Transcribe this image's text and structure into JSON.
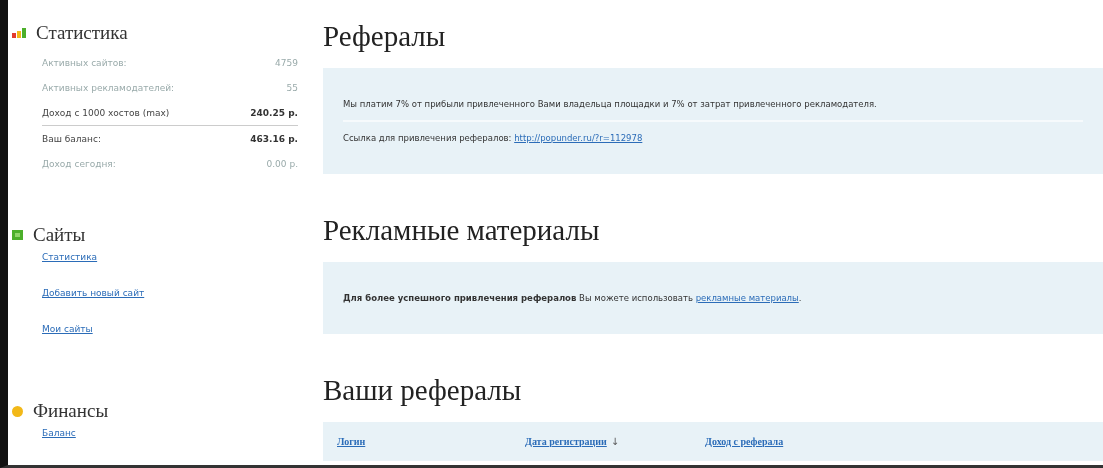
{
  "sidebar": [
    {
      "title": "Статистика",
      "kind": "bars",
      "color": "#4caf2a",
      "stats": [
        {
          "label": "Активных сайтов:",
          "value": "4759",
          "muted": true,
          "bold": false
        },
        {
          "label": "Активных рекламодателей:",
          "value": "55",
          "muted": true,
          "bold": false
        },
        {
          "label": "Доход с 1000 хостов (max)",
          "value": "240.25 р.",
          "muted": false,
          "bold": true
        },
        {
          "label": "Ваш баланс:",
          "value": "463.16 р.",
          "muted": false,
          "bold": true
        },
        {
          "label": "Доход сегодня:",
          "value": "0.00 р.",
          "muted": true,
          "bold": false
        }
      ]
    },
    {
      "title": "Сайты",
      "kind": "square",
      "color": "#4caf2a",
      "links": [
        "Статистика",
        "Добавить новый сайт",
        "Мои сайты"
      ]
    },
    {
      "title": "Финансы",
      "kind": "circle",
      "color": "#f2b818",
      "links": [
        "Баланс"
      ]
    }
  ],
  "main": [
    {
      "title": "Рефералы",
      "panel": {
        "kind": "lines",
        "lines": [
          {
            "text": "Мы платим 7% от прибыли привлеченного Вами владельца площадки и 7% от затрат привлеченного рекламодателя."
          },
          {
            "text": "Ссылка для привлечения рефералов: ",
            "link": "http://popunder.ru/?r=112978"
          }
        ]
      }
    },
    {
      "title": "Рекламные материалы",
      "panel": {
        "kind": "lines",
        "lines": [
          {
            "text": "**Для более успешного привлечения рефералов** Вы можете использовать ",
            "link": "рекламные материалы",
            "after": "."
          }
        ]
      }
    },
    {
      "title": "Ваши рефералы",
      "panel": {
        "kind": "table",
        "columns": [
          {
            "label": "Логин"
          },
          {
            "label": "Дата регистрации",
            "arrow": "↓"
          },
          {
            "label": "Доход с реферала"
          }
        ]
      }
    }
  ]
}
